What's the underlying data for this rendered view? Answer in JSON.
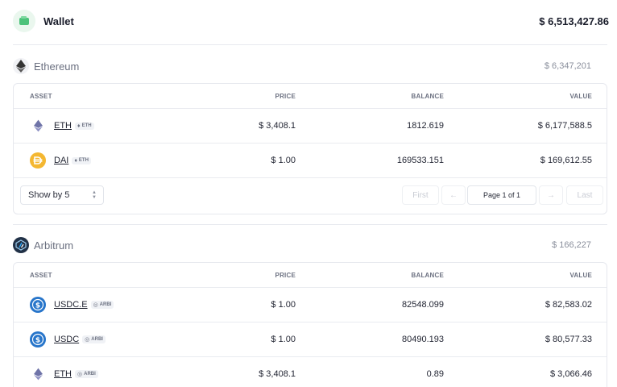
{
  "header": {
    "title": "Wallet",
    "total": "$ 6,513,427.86"
  },
  "columns": {
    "asset": "ASSET",
    "price": "PRICE",
    "balance": "BALANCE",
    "value": "VALUE"
  },
  "ethereum": {
    "name": "Ethereum",
    "total": "$ 6,347,201",
    "rows": [
      {
        "token": "ETH",
        "chain": "ETH",
        "price": "$ 3,408.1",
        "balance": "1812.619",
        "value": "$ 6,177,588.5"
      },
      {
        "token": "DAI",
        "chain": "ETH",
        "price": "$ 1.00",
        "balance": "169533.151",
        "value": "$ 169,612.55"
      }
    ],
    "pagination": {
      "show_by": "Show by 5",
      "first": "First",
      "prev": "←",
      "page": "Page 1 of 1",
      "next": "→",
      "last": "Last"
    }
  },
  "arbitrum": {
    "name": "Arbitrum",
    "total": "$ 166,227",
    "rows": [
      {
        "token": "USDC.E",
        "chain": "ARBI",
        "price": "$ 1.00",
        "balance": "82548.099",
        "value": "$ 82,583.02"
      },
      {
        "token": "USDC",
        "chain": "ARBI",
        "price": "$ 1.00",
        "balance": "80490.193",
        "value": "$ 80,577.33"
      },
      {
        "token": "ETH",
        "chain": "ARBI",
        "price": "$ 3,408.1",
        "balance": "0.89",
        "value": "$ 3,066.46"
      }
    ]
  },
  "colors": {
    "accent_green": "#4cc27a",
    "dai_yellow": "#f4b731",
    "usdc_blue": "#2775ca",
    "arbitrum_navy": "#213147"
  }
}
